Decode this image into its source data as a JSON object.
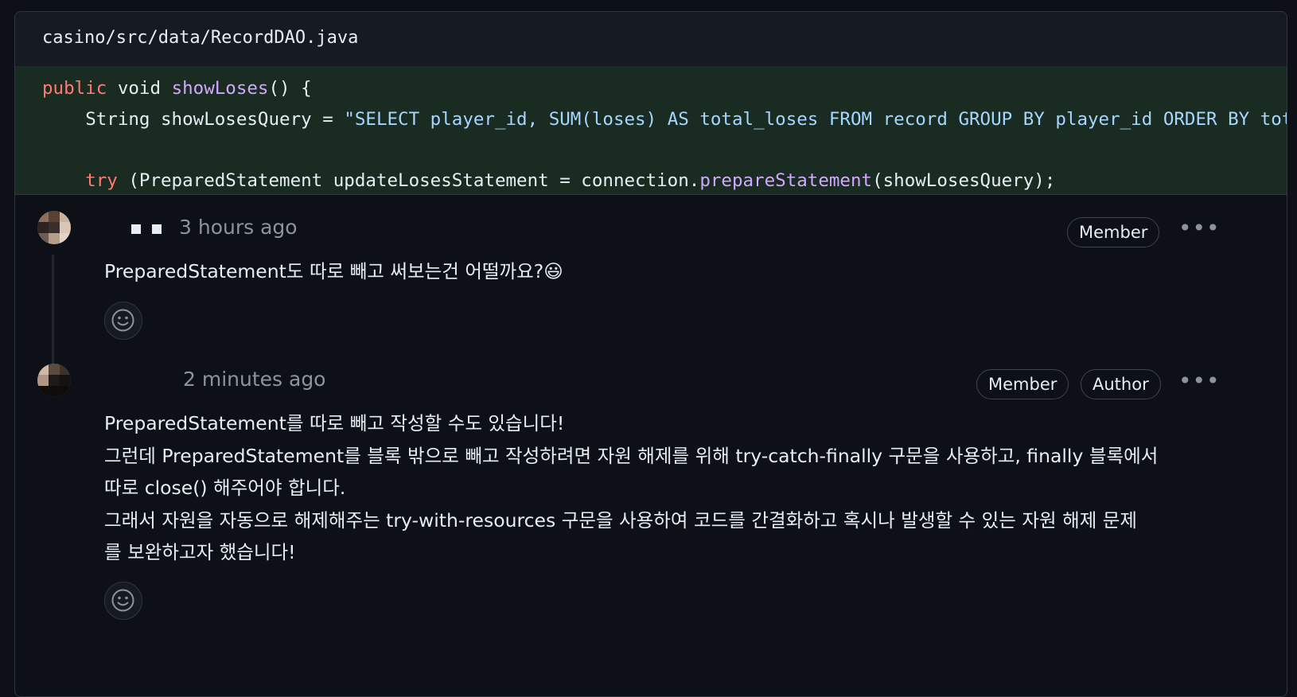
{
  "file": {
    "path": "casino/src/data/RecordDAO.java"
  },
  "code": {
    "line1": {
      "kw": "public",
      "type": " void ",
      "fn": "showLoses",
      "rest": "() {"
    },
    "line2": {
      "indent": "    ",
      "type": "String",
      "var": " showLosesQuery = ",
      "str": "\"SELECT player_id, SUM(loses) AS total_loses FROM record GROUP BY player_id ORDER BY total_loses DESC\";"
    },
    "line3": {
      "indent": "    ",
      "kw": "try",
      "rest1": " (PreparedStatement updateLosesStatement = connection.",
      "fn": "prepareStatement",
      "rest2": "(showLosesQuery);"
    }
  },
  "comments": [
    {
      "timestamp": "3 hours ago",
      "badges": [
        "Member"
      ],
      "text": [
        "PreparedStatement도 따로 빼고 써보는건 어떨까요?😃"
      ]
    },
    {
      "timestamp": "2 minutes ago",
      "badges": [
        "Member",
        "Author"
      ],
      "text": [
        "PreparedStatement를 따로 빼고 작성할 수도 있습니다!",
        "그런데 PreparedStatement를 블록 밖으로 빼고 작성하려면 자원 해제를 위해 try-catch-finally 구문을 사용하고, finally 블록에서",
        "따로 close() 해주어야 합니다.",
        "그래서 자원을 자동으로 해제해주는 try-with-resources 구문을 사용하여 코드를 간결화하고 혹시나 발생할 수 있는 자원 해제 문제",
        "를 보완하고자 했습니다!"
      ]
    }
  ],
  "icons": {
    "more": "kebab-horizontal-icon",
    "reaction": "smiley-icon"
  },
  "colors": {
    "background": "#0d1117",
    "code_bg": "#1a2b22",
    "keyword": "#ff7b72",
    "function": "#d2a8ff",
    "string": "#a5d6ff",
    "muted": "#8b949e"
  }
}
